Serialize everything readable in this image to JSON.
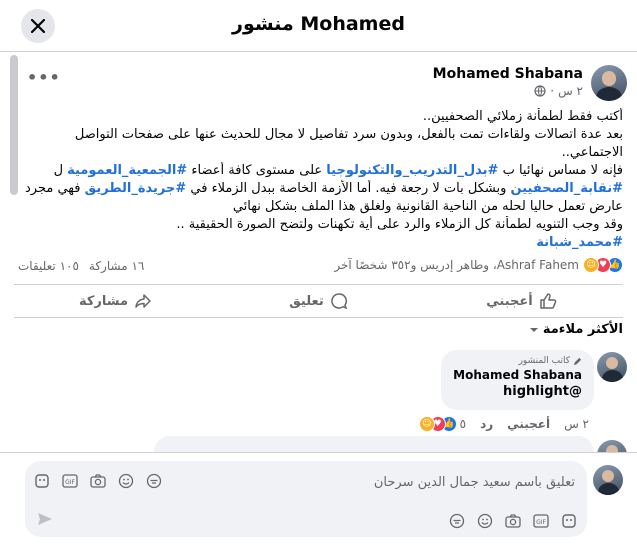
{
  "header": {
    "title": "منشور Mohamed"
  },
  "post": {
    "author": "Mohamed Shabana",
    "time": "٢ س",
    "lines": [
      "أكتب  فقط لطمأنة زملائي الصحفيين..",
      "بعد عدة اتصالات ولقاءات تمت بالفعل، وبدون سرد تفاصيل لا مجال للحديث عنها على صفحات التواصل",
      "الاجتماعي.."
    ],
    "line4": {
      "a": "فإنه لا مساس نهائيا ب ",
      "tag1": "#بدل_التدريب_والتكنولوجيا",
      "b": " على مستوى كافة أعضاء ",
      "tag2": "#الجمعية_العمومية",
      "c": " ل"
    },
    "line5": {
      "tag1": "#نقابة_الصحفيين",
      "a": " وبشكل بات لا رجعة فيه. أما الأزمة الخاصة ببدل الزملاء في ",
      "tag2": "#جريدة_الطريق",
      "b": " فهي مجرد موقف"
    },
    "line6": "عارض تعمل حاليا لحله  من الناحية القانونية ولغلق هذا الملف بشكل نهائي",
    "line7": "وقد وجب التنويه لطمأنة كل الزملاء والرد على أية تكهنات ولتضح الصورة الحقيقية ..",
    "signature_tag": "#محمد_شبانة"
  },
  "stats": {
    "reactors": "Ashraf Fahem، وطاهر إدريس و٣٥٢ شخصًا آخر",
    "comments": "١٠٥ تعليقات",
    "shares": "١٦ مشاركة"
  },
  "actions": {
    "like": "أعجبني",
    "comment": "تعليق",
    "share": "مشاركة"
  },
  "sort_label": "الأكثر ملاءمة",
  "comment": {
    "badge": "كاتب المنشور",
    "author": "Mohamed Shabana",
    "text": "@highlight",
    "time": "٢ س",
    "like": "أعجبني",
    "reply": "رد",
    "reaction_count": "٥"
  },
  "composer": {
    "placeholder": "تعليق باسم سعيد جمال الدين سرحان"
  },
  "colors": {
    "link": "#216fdb",
    "like_blue": "#1877f2",
    "love_red": "#f33e58",
    "haha_yellow": "#f7b125"
  }
}
